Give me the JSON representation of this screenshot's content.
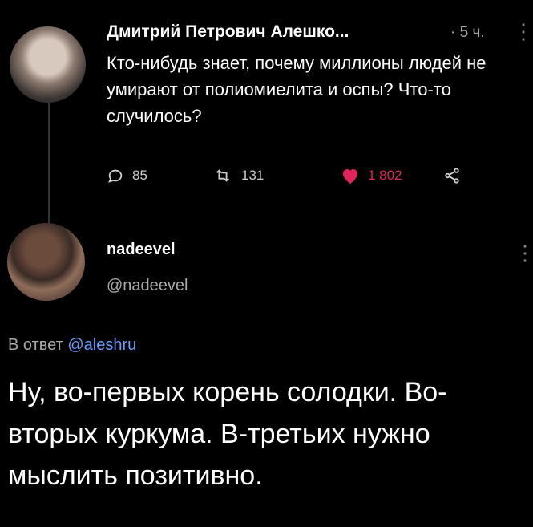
{
  "post": {
    "author_name": "Дмитрий Петрович Алешко...",
    "time": "· 5 ч.",
    "text": "Кто-нибудь знает, почему миллионы людей не умирают от полиомиелита и оспы? Что-то случилось?",
    "replies_count": "85",
    "retweets_count": "131",
    "likes_count": "1 802"
  },
  "reply": {
    "author_name": "nadeevel",
    "handle": "@nadeevel",
    "reply_prefix": "В ответ",
    "reply_mention": "@aleshru",
    "text": "Ну, во-первых корень солодки. Во-вторых куркума. В-третьих нужно мыслить позитивно."
  },
  "icons": {
    "reply": "comment-icon",
    "retweet": "retweet-icon",
    "like": "heart-icon",
    "share": "share-icon",
    "menu": "more-vertical-icon"
  },
  "colors": {
    "background": "#000000",
    "like": "#e0245e",
    "mention": "#6d9cff"
  }
}
